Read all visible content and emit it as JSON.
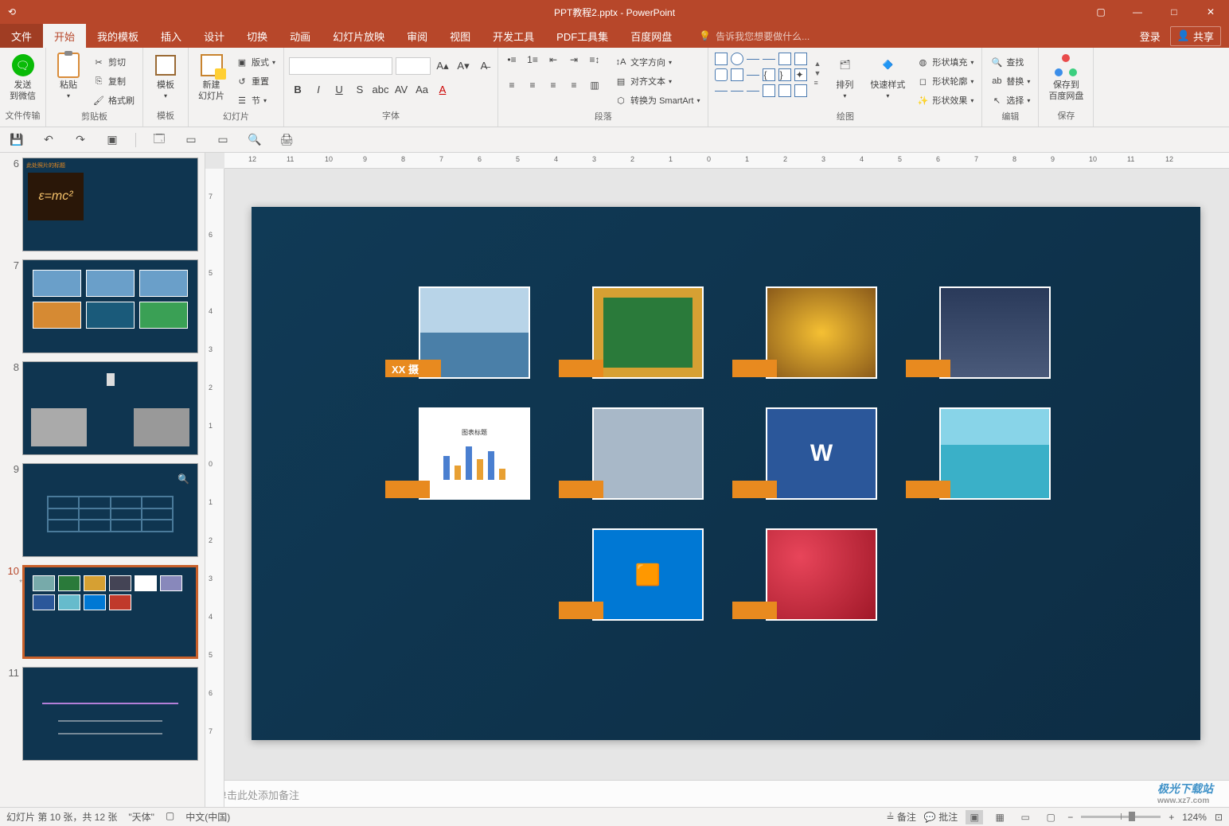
{
  "title": {
    "filename": "PPT教程2.pptx",
    "app": "PowerPoint"
  },
  "window_controls": {
    "ribbon_opts": "▢",
    "min": "—",
    "max": "□",
    "close": "✕"
  },
  "menu": {
    "tabs": [
      "文件",
      "开始",
      "我的模板",
      "插入",
      "设计",
      "切换",
      "动画",
      "幻灯片放映",
      "审阅",
      "视图",
      "开发工具",
      "PDF工具集",
      "百度网盘"
    ],
    "tell_me": "告诉我您想要做什么...",
    "login": "登录",
    "share": "共享"
  },
  "ribbon": {
    "group_wechat": {
      "label": "文件传输",
      "btn": "发送\n到微信"
    },
    "group_clipboard": {
      "label": "剪贴板",
      "paste": "粘贴",
      "cut": "剪切",
      "copy": "复制",
      "format_painter": "格式刷"
    },
    "group_template": {
      "label": "模板",
      "btn": "模板"
    },
    "group_slides": {
      "label": "幻灯片",
      "new_slide": "新建\n幻灯片",
      "layout": "版式",
      "reset": "重置",
      "section": "节"
    },
    "group_font": {
      "label": "字体"
    },
    "group_paragraph": {
      "label": "段落",
      "text_dir": "文字方向",
      "align_text": "对齐文本",
      "smartart": "转换为 SmartArt"
    },
    "group_drawing": {
      "label": "绘图",
      "arrange": "排列",
      "quick_styles": "快速样式",
      "shape_fill": "形状填充",
      "shape_outline": "形状轮廓",
      "shape_effects": "形状效果"
    },
    "group_editing": {
      "label": "编辑",
      "find": "查找",
      "replace": "替换",
      "select": "选择"
    },
    "group_save": {
      "label": "保存",
      "baidu": "保存到\n百度网盘"
    }
  },
  "thumbnails": [
    {
      "num": "6"
    },
    {
      "num": "7"
    },
    {
      "num": "8"
    },
    {
      "num": "9"
    },
    {
      "num": "10",
      "selected": true,
      "star": "*"
    },
    {
      "num": "11"
    }
  ],
  "slide": {
    "row1": [
      {
        "caption": "XX 摄",
        "caption_visible": true
      },
      {
        "caption": ""
      },
      {
        "caption": ""
      },
      {
        "caption": ""
      }
    ],
    "row2": [
      {
        "caption": ""
      },
      {
        "caption": ""
      },
      {
        "caption": ""
      },
      {
        "caption": ""
      }
    ],
    "row3": [
      {
        "caption": ""
      },
      {
        "caption": ""
      }
    ]
  },
  "ruler_h": [
    "12",
    "11",
    "10",
    "9",
    "8",
    "7",
    "6",
    "5",
    "4",
    "3",
    "2",
    "1",
    "0",
    "1",
    "2",
    "3",
    "4",
    "5",
    "6",
    "7",
    "8",
    "9",
    "10",
    "11",
    "12"
  ],
  "ruler_v": [
    "7",
    "6",
    "5",
    "4",
    "3",
    "2",
    "1",
    "0",
    "1",
    "2",
    "3",
    "4",
    "5",
    "6",
    "7"
  ],
  "notes": {
    "placeholder": "单击此处添加备注"
  },
  "status": {
    "slide_pos": "幻灯片 第 10 张，共 12 张",
    "theme": "\"天体\"",
    "lang_icon": "▢",
    "lang": "中文(中国)",
    "notes_btn": "备注",
    "comments_btn": "批注",
    "zoom": "124%",
    "fit": "⊡"
  },
  "watermark": {
    "brand": "极光下载站",
    "url": "www.xz7.com"
  }
}
